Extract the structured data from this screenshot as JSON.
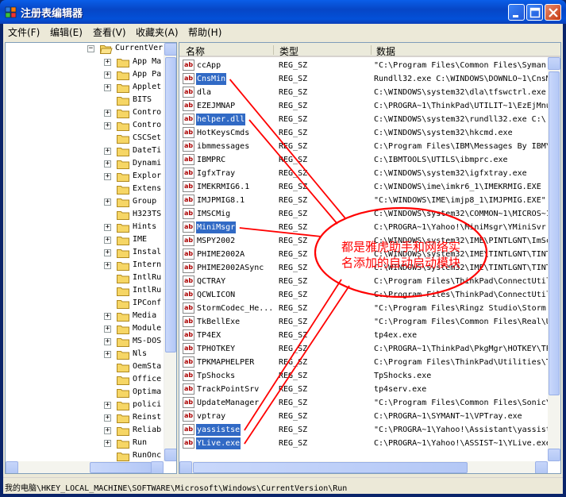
{
  "window": {
    "title": "注册表编辑器"
  },
  "menu": [
    "文件(F)",
    "编辑(E)",
    "查看(V)",
    "收藏夹(A)",
    "帮助(H)"
  ],
  "tree": {
    "parent": "CurrentVer",
    "items": [
      {
        "label": "App Ma",
        "expandable": true
      },
      {
        "label": "App Pa",
        "expandable": true
      },
      {
        "label": "Applet",
        "expandable": true
      },
      {
        "label": "BITS",
        "expandable": false
      },
      {
        "label": "Contro",
        "expandable": true
      },
      {
        "label": "Contro",
        "expandable": true
      },
      {
        "label": "CSCSet",
        "expandable": false
      },
      {
        "label": "DateTi",
        "expandable": true
      },
      {
        "label": "Dynami",
        "expandable": true
      },
      {
        "label": "Explor",
        "expandable": true
      },
      {
        "label": "Extens",
        "expandable": false
      },
      {
        "label": "Group",
        "expandable": true
      },
      {
        "label": "H323TS",
        "expandable": false
      },
      {
        "label": "Hints",
        "expandable": true
      },
      {
        "label": "IME",
        "expandable": true
      },
      {
        "label": "Instal",
        "expandable": true
      },
      {
        "label": "Intern",
        "expandable": true
      },
      {
        "label": "IntlRu",
        "expandable": false
      },
      {
        "label": "IntlRu",
        "expandable": false
      },
      {
        "label": "IPConf",
        "expandable": false
      },
      {
        "label": "Media",
        "expandable": true
      },
      {
        "label": "Module",
        "expandable": true
      },
      {
        "label": "MS-DOS",
        "expandable": true
      },
      {
        "label": "Nls",
        "expandable": true
      },
      {
        "label": "OemSta",
        "expandable": false
      },
      {
        "label": "Office",
        "expandable": false
      },
      {
        "label": "Optima",
        "expandable": false
      },
      {
        "label": "polici",
        "expandable": true
      },
      {
        "label": "Reinst",
        "expandable": true
      },
      {
        "label": "Reliab",
        "expandable": true
      },
      {
        "label": "Run",
        "expandable": true
      },
      {
        "label": "RunOnc",
        "expandable": false
      }
    ]
  },
  "list": {
    "headers": {
      "name": "名称",
      "type": "类型",
      "data": "数据"
    },
    "rows": [
      {
        "name": "ccApp",
        "type": "REG_SZ",
        "data": "\"C:\\Program Files\\Common Files\\Syman",
        "selected": false
      },
      {
        "name": "CnsMin",
        "type": "REG_SZ",
        "data": "Rundll32.exe C:\\WINDOWS\\DOWNLO~1\\CnsM",
        "selected": true
      },
      {
        "name": "dla",
        "type": "REG_SZ",
        "data": "C:\\WINDOWS\\system32\\dla\\tfswctrl.exe",
        "selected": false
      },
      {
        "name": "EZEJMNAP",
        "type": "REG_SZ",
        "data": "C:\\PROGRA~1\\ThinkPad\\UTILIT~1\\EzEjMnu",
        "selected": false
      },
      {
        "name": "helper.dll",
        "type": "REG_SZ",
        "data": "C:\\WINDOWS\\system32\\rundll32.exe C:\\",
        "selected": true
      },
      {
        "name": "HotKeysCmds",
        "type": "REG_SZ",
        "data": "C:\\WINDOWS\\system32\\hkcmd.exe",
        "selected": false
      },
      {
        "name": "ibmmessages",
        "type": "REG_SZ",
        "data": "C:\\Program Files\\IBM\\Messages By IBM\\",
        "selected": false
      },
      {
        "name": "IBMPRC",
        "type": "REG_SZ",
        "data": "C:\\IBMTOOLS\\UTILS\\ibmprc.exe",
        "selected": false
      },
      {
        "name": "IgfxTray",
        "type": "REG_SZ",
        "data": "C:\\WINDOWS\\system32\\igfxtray.exe",
        "selected": false
      },
      {
        "name": "IMEKRMIG6.1",
        "type": "REG_SZ",
        "data": "C:\\WINDOWS\\ime\\imkr6_1\\IMEKRMIG.EXE",
        "selected": false
      },
      {
        "name": "IMJPMIG8.1",
        "type": "REG_SZ",
        "data": "\"C:\\WINDOWS\\IME\\imjp8_1\\IMJPMIG.EXE\"",
        "selected": false
      },
      {
        "name": "IMSCMig",
        "type": "REG_SZ",
        "data": "C:\\WINDOWS\\system32\\COMMON~1\\MICROS~1\\IME\\IMS",
        "selected": false
      },
      {
        "name": "MiniMsgr",
        "type": "REG_SZ",
        "data": "C:\\PROGRA~1\\Yahoo!\\MiniMsgr\\YMiniSvr.",
        "selected": true
      },
      {
        "name": "MSPY2002",
        "type": "REG_SZ",
        "data": "C:\\WINDOWS\\system32\\IME\\PINTLGNT\\ImSc",
        "selected": false
      },
      {
        "name": "PHIME2002A",
        "type": "REG_SZ",
        "data": "C:\\WINDOWS\\system32\\IME\\TINTLGNT\\TINT",
        "selected": false
      },
      {
        "name": "PHIME2002ASync",
        "type": "REG_SZ",
        "data": "C:\\WINDOWS\\system32\\IME\\TINTLGNT\\TINT",
        "selected": false
      },
      {
        "name": "QCTRAY",
        "type": "REG_SZ",
        "data": "C:\\Program Files\\ThinkPad\\ConnectUtil",
        "selected": false
      },
      {
        "name": "QCWLICON",
        "type": "REG_SZ",
        "data": "C:\\Program Files\\ThinkPad\\ConnectUtil",
        "selected": false
      },
      {
        "name": "StormCodec_He...",
        "type": "REG_SZ",
        "data": "\"C:\\Program Files\\Ringz Studio\\Storm",
        "selected": false
      },
      {
        "name": "TkBellExe",
        "type": "REG_SZ",
        "data": "\"C:\\Program Files\\Common Files\\Real\\U",
        "selected": false
      },
      {
        "name": "TP4EX",
        "type": "REG_SZ",
        "data": "tp4ex.exe",
        "selected": false
      },
      {
        "name": "TPHOTKEY",
        "type": "REG_SZ",
        "data": "C:\\PROGRA~1\\ThinkPad\\PkgMgr\\HOTKEY\\TP",
        "selected": false
      },
      {
        "name": "TPKMAPHELPER",
        "type": "REG_SZ",
        "data": "C:\\Program Files\\ThinkPad\\Utilities\\T",
        "selected": false
      },
      {
        "name": "TpShocks",
        "type": "REG_SZ",
        "data": "TpShocks.exe",
        "selected": false
      },
      {
        "name": "TrackPointSrv",
        "type": "REG_SZ",
        "data": "tp4serv.exe",
        "selected": false
      },
      {
        "name": "UpdateManager",
        "type": "REG_SZ",
        "data": "\"C:\\Program Files\\Common Files\\Sonic\\",
        "selected": false
      },
      {
        "name": "vptray",
        "type": "REG_SZ",
        "data": "C:\\PROGRA~1\\SYMANT~1\\VPTray.exe",
        "selected": false
      },
      {
        "name": "yassistse",
        "type": "REG_SZ",
        "data": "\"C:\\PROGRA~1\\Yahoo!\\Assistant\\yassist",
        "selected": true
      },
      {
        "name": "YLive.exe",
        "type": "REG_SZ",
        "data": "C:\\PROGRA~1\\Yahoo!\\ASSIST~1\\YLive.exe",
        "selected": true
      }
    ]
  },
  "annotation": {
    "lines": [
      "都是雅虎助手和网络实",
      "名添加的自动启动模块"
    ],
    "color": "#ff0000"
  },
  "status_path": "我的电脑\\HKEY_LOCAL_MACHINE\\SOFTWARE\\Microsoft\\Windows\\CurrentVersion\\Run"
}
